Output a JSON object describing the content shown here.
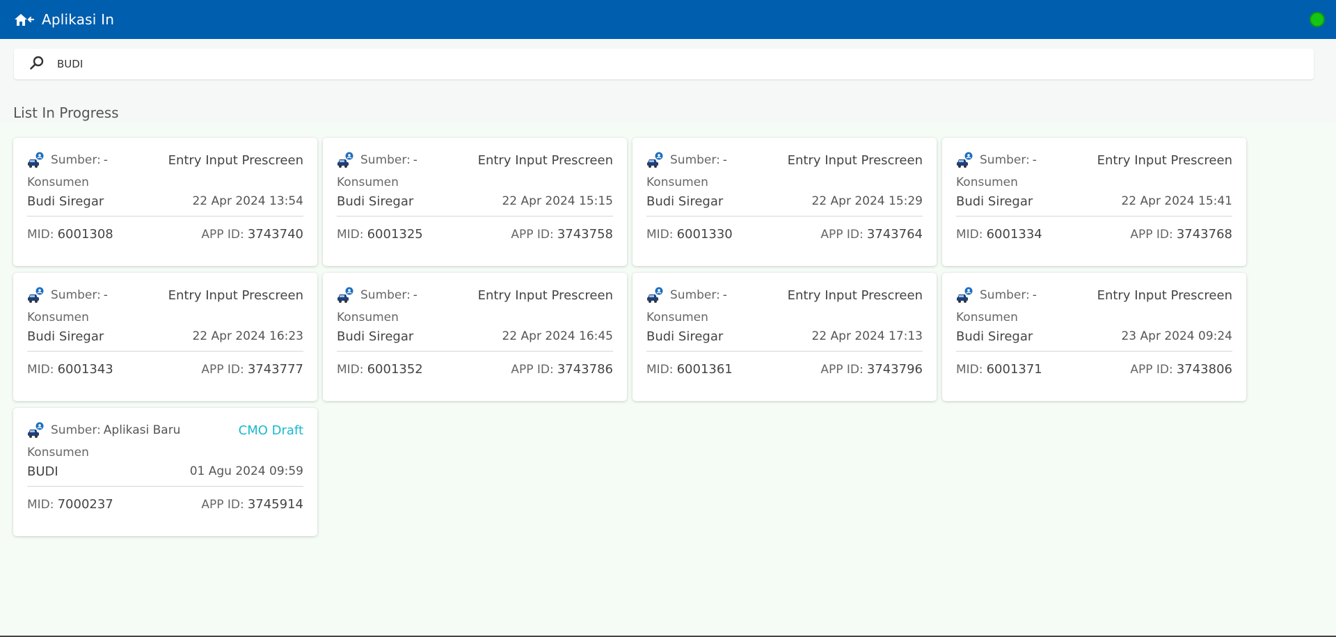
{
  "app": {
    "title": "Aplikasi In",
    "status_color": "#15c515",
    "brand_color": "#005eae"
  },
  "search": {
    "value": "BUDI",
    "icon": "search-icon"
  },
  "section_title": "List In Progress",
  "labels": {
    "source": "Sumber:",
    "consumer": "Konsumen",
    "mid": "MID:",
    "app_id": "APP ID:"
  },
  "cards": [
    {
      "source": "-",
      "status": "Entry Input Prescreen",
      "name": "Budi Siregar",
      "date": "22 Apr 2024 13:54",
      "mid": "6001308",
      "app_id": "3743740",
      "status_kind": "normal"
    },
    {
      "source": "-",
      "status": "Entry Input Prescreen",
      "name": "Budi Siregar",
      "date": "22 Apr 2024 15:15",
      "mid": "6001325",
      "app_id": "3743758",
      "status_kind": "normal"
    },
    {
      "source": "-",
      "status": "Entry Input Prescreen",
      "name": "Budi Siregar",
      "date": "22 Apr 2024 15:29",
      "mid": "6001330",
      "app_id": "3743764",
      "status_kind": "normal"
    },
    {
      "source": "-",
      "status": "Entry Input Prescreen",
      "name": "Budi Siregar",
      "date": "22 Apr 2024 15:41",
      "mid": "6001334",
      "app_id": "3743768",
      "status_kind": "normal"
    },
    {
      "source": "-",
      "status": "Entry Input Prescreen",
      "name": "Budi Siregar",
      "date": "22 Apr 2024 16:23",
      "mid": "6001343",
      "app_id": "3743777",
      "status_kind": "normal"
    },
    {
      "source": "-",
      "status": "Entry Input Prescreen",
      "name": "Budi Siregar",
      "date": "22 Apr 2024 16:45",
      "mid": "6001352",
      "app_id": "3743786",
      "status_kind": "normal"
    },
    {
      "source": "-",
      "status": "Entry Input Prescreen",
      "name": "Budi Siregar",
      "date": "22 Apr 2024 17:13",
      "mid": "6001361",
      "app_id": "3743796",
      "status_kind": "normal"
    },
    {
      "source": "-",
      "status": "Entry Input Prescreen",
      "name": "Budi Siregar",
      "date": "23 Apr 2024 09:24",
      "mid": "6001371",
      "app_id": "3743806",
      "status_kind": "normal"
    },
    {
      "source": "Aplikasi Baru",
      "status": "CMO Draft",
      "name": "BUDI",
      "date": "01 Agu 2024 09:59",
      "mid": "7000237",
      "app_id": "3745914",
      "status_kind": "cmo",
      "status_color": "#1ab8cf"
    }
  ]
}
